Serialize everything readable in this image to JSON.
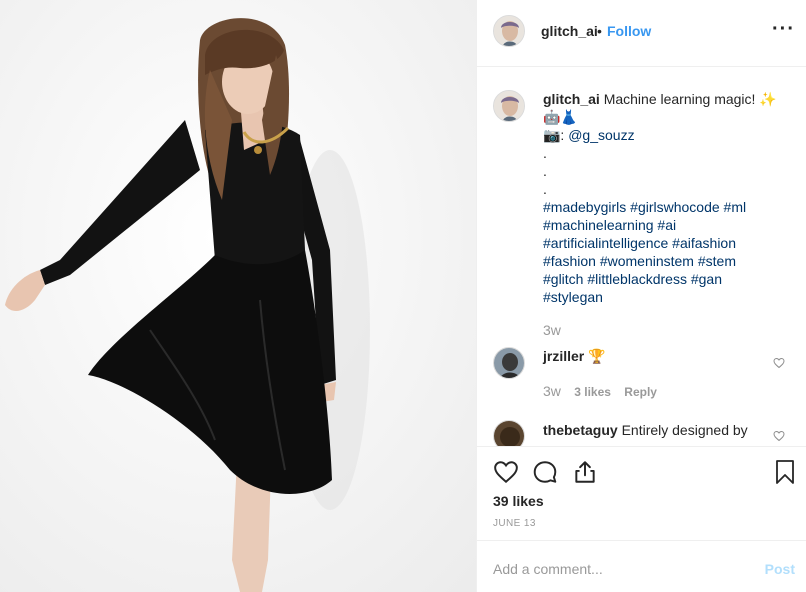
{
  "post": {
    "username": "glitch_ai",
    "separator": "•",
    "follow_label": "Follow",
    "more_icon": "more-options-icon"
  },
  "caption": {
    "username": "glitch_ai",
    "text": "Machine learning magic! ✨",
    "emoji_line": "🤖👗",
    "credit_prefix": "📷: ",
    "credit_handle": "@g_souzz",
    "dots": [
      ".",
      ".",
      "."
    ],
    "hashtag_lines": [
      "#madebygirls #girlswhocode #ml",
      "#machinelearning #ai",
      "#artificialintelligence #aifashion",
      "#fashion #womeninstem #stem",
      "#glitch #littleblackdress #gan",
      "#stylegan"
    ],
    "time": "3w"
  },
  "comments": [
    {
      "username": "jrziller",
      "text": "🏆",
      "time": "3w",
      "likes": "3 likes",
      "reply": "Reply"
    },
    {
      "username": "thebetaguy",
      "text": "Entirely designed by"
    }
  ],
  "actions": {
    "like_icon": "heart-icon",
    "comment_icon": "comment-icon",
    "share_icon": "share-icon",
    "save_icon": "bookmark-icon"
  },
  "likes_count": "39 likes",
  "date": "JUNE 13",
  "add_comment": {
    "placeholder": "Add a comment...",
    "post_label": "Post"
  },
  "colors": {
    "accent": "#3897f0",
    "post_disabled": "#b2dffc",
    "link": "#003569",
    "muted": "#999999",
    "border": "#efefef"
  }
}
